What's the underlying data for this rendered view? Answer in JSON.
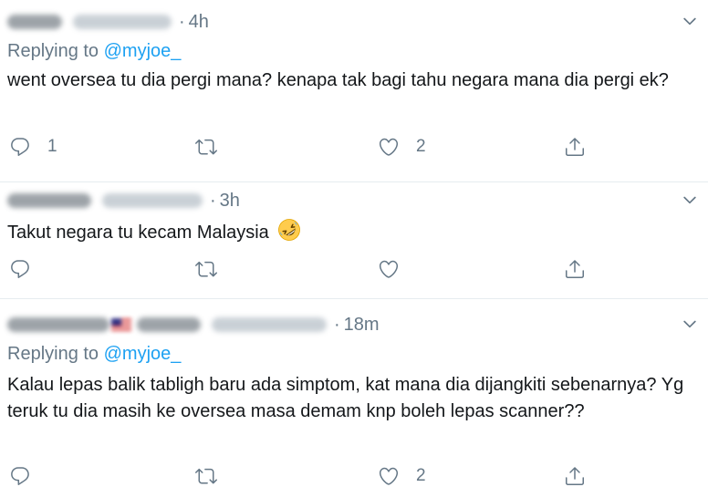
{
  "tweets": [
    {
      "name_blurred": true,
      "separator": "·",
      "time": "4h",
      "replying_prefix": "Replying to",
      "replying_handle": "@myjoe_",
      "text": "went oversea tu dia pergi mana? kenapa tak bagi tahu negara mana dia pergi ek?",
      "reply_count": "1",
      "retweet_count": "",
      "like_count": "2"
    },
    {
      "name_blurred": true,
      "separator": "·",
      "time": "3h",
      "text": "Takut negara tu kecam Malaysia",
      "emoji": "rolling-on-floor-laughing",
      "reply_count": "",
      "retweet_count": "",
      "like_count": ""
    },
    {
      "name_blurred": true,
      "flag": "malaysia-flag",
      "separator": "·",
      "time": "18m",
      "replying_prefix": "Replying to",
      "replying_handle": "@myjoe_",
      "text": "Kalau lepas balik tabligh baru ada simptom, kat mana dia dijangkiti sebenarnya? Yg teruk tu dia masih ke oversea masa demam knp boleh lepas scanner??",
      "reply_count": "",
      "retweet_count": "",
      "like_count": "2"
    }
  ],
  "colors": {
    "text": "#14171a",
    "secondary": "#657786",
    "link": "#1da1f2",
    "divider": "#e6ecf0"
  },
  "icons": [
    "reply-icon",
    "retweet-icon",
    "like-icon",
    "share-icon",
    "chevron-down-icon"
  ]
}
